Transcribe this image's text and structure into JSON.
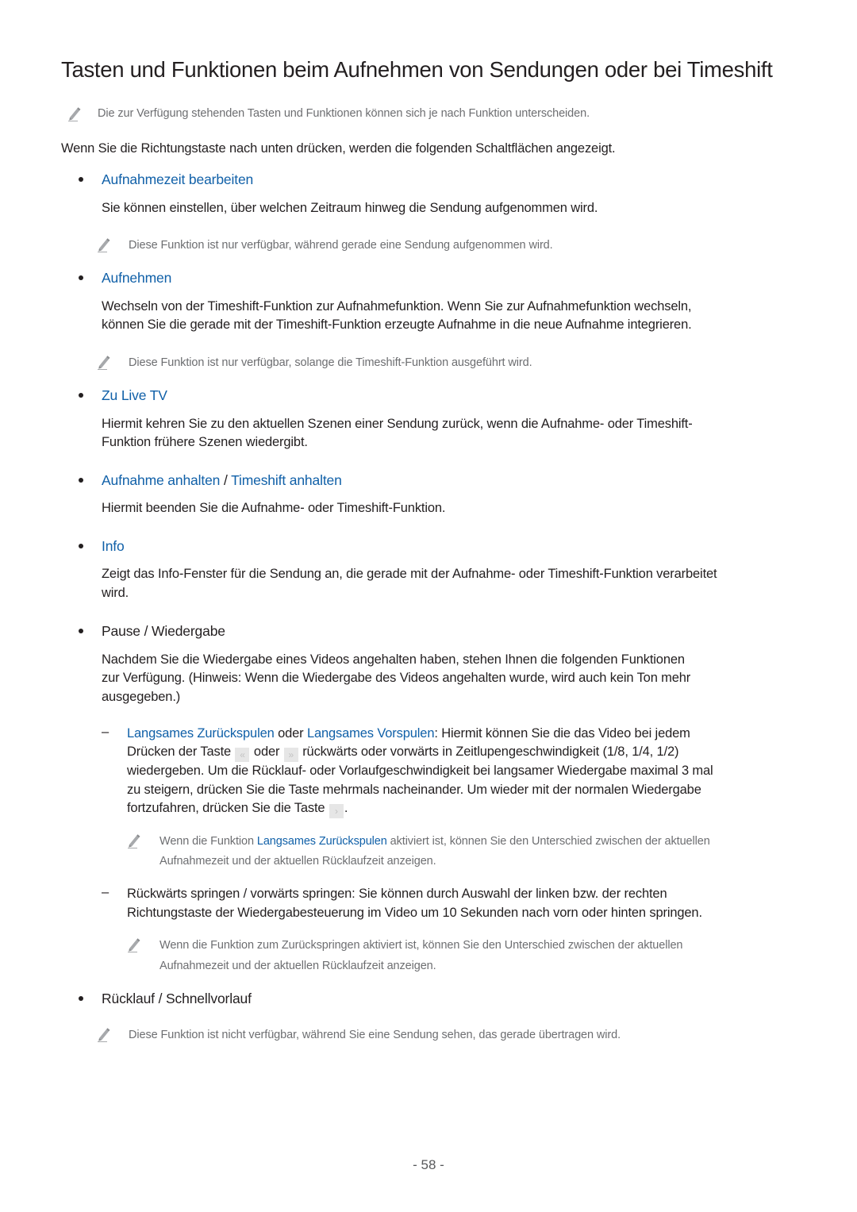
{
  "title": "Tasten und Funktionen beim Aufnehmen von Sendungen oder bei Timeshift",
  "intro_note": "Die zur Verfügung stehenden Tasten und Funktionen können sich je nach Funktion unterscheiden.",
  "intro_text": "Wenn Sie die Richtungstaste nach unten drücken, werden die folgenden Schaltflächen angezeigt.",
  "items": [
    {
      "heading": "Aufnahmezeit bearbeiten",
      "description": "Sie können einstellen, über welchen Zeitraum hinweg die Sendung aufgenommen wird.",
      "note": "Diese Funktion ist nur verfügbar, während gerade eine Sendung aufgenommen wird."
    },
    {
      "heading": "Aufnehmen",
      "description_lines": [
        "Wechseln von der Timeshift-Funktion zur Aufnahmefunktion. Wenn Sie zur Aufnahmefunktion wechseln,",
        "können Sie die gerade mit der Timeshift-Funktion erzeugte Aufnahme in die neue Aufnahme integrieren."
      ],
      "note": "Diese Funktion ist nur verfügbar, solange die Timeshift-Funktion ausgeführt wird."
    },
    {
      "heading": "Zu Live TV",
      "description_lines": [
        "Hiermit kehren Sie zu den aktuellen Szenen einer Sendung zurück, wenn die Aufnahme- oder Timeshift-",
        "Funktion frühere Szenen wiedergibt."
      ]
    },
    {
      "heading_part1": "Aufnahme anhalten",
      "heading_sep": " / ",
      "heading_part2": "Timeshift anhalten",
      "description": "Hiermit beenden Sie die Aufnahme- oder Timeshift-Funktion."
    },
    {
      "heading": "Info",
      "description_lines": [
        "Zeigt das Info-Fenster für die Sendung an, die gerade mit der Aufnahme- oder Timeshift-Funktion verarbeitet",
        "wird."
      ]
    },
    {
      "heading": "Pause / Wiedergabe",
      "description_lines": [
        "Nachdem Sie die Wiedergabe eines Videos angehalten haben, stehen Ihnen die folgenden Funktionen",
        "zur Verfügung. (Hinweis: Wenn die Wiedergabe des Videos angehalten wurde, wird auch kein Ton mehr",
        "ausgegeben.)"
      ],
      "subitems": [
        {
          "dash": "–",
          "link1": "Langsames Zurückspulen",
          "connector": " oder ",
          "link2": "Langsames Vorspulen",
          "line1_rest": ": Hiermit können Sie die das Video bei jedem",
          "line2_a": "Drücken der Taste ",
          "key_rewind": "«",
          "line2_b": " oder ",
          "key_forward": "»",
          "line2_c": " rückwärts oder vorwärts in Zeitlupengeschwindigkeit (1/8, 1/4, 1/2)",
          "line3": "wiedergeben. Um die Rücklauf- oder Vorlaufgeschwindigkeit bei langsamer Wiedergabe maximal 3 mal",
          "line4": "zu steigern, drücken Sie die Taste mehrmals nacheinander. Um wieder mit der normalen Wiedergabe",
          "line5_a": "fortzufahren, drücken Sie die Taste ",
          "key_play": "›",
          "line5_b": ".",
          "note_a": "Wenn die Funktion ",
          "note_link": "Langsames Zurückspulen",
          "note_b": " aktiviert ist, können Sie den Unterschied zwischen der aktuellen",
          "note_line2": "Aufnahmezeit und der aktuellen Rücklaufzeit anzeigen."
        },
        {
          "dash": "–",
          "line1": "Rückwärts springen / vorwärts springen: Sie können durch Auswahl der linken bzw. der rechten",
          "line2": "Richtungstaste der Wiedergabesteuerung im Video um 10 Sekunden nach vorn oder hinten springen.",
          "note_line1": "Wenn die Funktion zum Zurückspringen aktiviert ist, können Sie den Unterschied zwischen der aktuellen",
          "note_line2": "Aufnahmezeit und der aktuellen Rücklaufzeit anzeigen."
        }
      ]
    },
    {
      "heading": "Rücklauf / Schnellvorlauf",
      "note": "Diese Funktion ist nicht verfügbar, während Sie eine Sendung sehen, das gerade übertragen wird."
    }
  ],
  "page_number": "- 58 -",
  "colors": {
    "link_blue": "#1060a8",
    "text": "#231f20",
    "note_gray": "#6d6e71"
  }
}
